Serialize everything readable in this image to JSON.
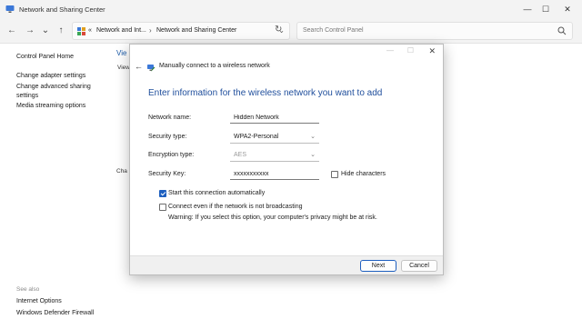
{
  "window": {
    "title": "Network and Sharing Center",
    "minimize": "—",
    "maximize": "☐",
    "close": "✕"
  },
  "nav": {
    "back": "←",
    "forward": "→",
    "recent": "⌄",
    "up": "↑",
    "address_prefix": "«",
    "address_seg1": "Network and Int...",
    "address_seg2": "Network and Sharing Center",
    "refresh": "↻",
    "search_placeholder": "Search Control Panel"
  },
  "sidebar": {
    "items": [
      {
        "label": "Control Panel Home"
      },
      {
        "label": "Change adapter settings"
      },
      {
        "label": "Change advanced sharing settings"
      },
      {
        "label": "Media streaming options"
      }
    ],
    "see_also": "See also",
    "footer_items": [
      {
        "label": "Internet Options"
      },
      {
        "label": "Windows Defender Firewall"
      }
    ]
  },
  "background": {
    "heading_fragment": "Vie",
    "sub_fragment": "View",
    "change_fragment": "Cha"
  },
  "dialog": {
    "title": "Manually connect to a wireless network",
    "heading": "Enter information for the wireless network you want to add",
    "fields": {
      "network_name_label": "Network name:",
      "network_name_value": "Hidden Network",
      "security_type_label": "Security type:",
      "security_type_value": "WPA2-Personal",
      "encryption_type_label": "Encryption type:",
      "encryption_type_value": "AES",
      "security_key_label": "Security Key:",
      "security_key_value": "xxxxxxxxxxx",
      "hide_characters_label": "Hide characters"
    },
    "options": {
      "start_auto_label": "Start this connection automatically",
      "start_auto_checked": true,
      "connect_even_label": "Connect even if the network is not broadcasting",
      "connect_even_checked": false,
      "warning": "Warning: If you select this option, your computer's privacy might be at risk."
    },
    "buttons": {
      "next": "Next",
      "cancel": "Cancel"
    },
    "back_icon": "←",
    "close": "✕"
  },
  "colors": {
    "accent": "#1e5fbf",
    "heading_blue": "#1f4e9c"
  }
}
